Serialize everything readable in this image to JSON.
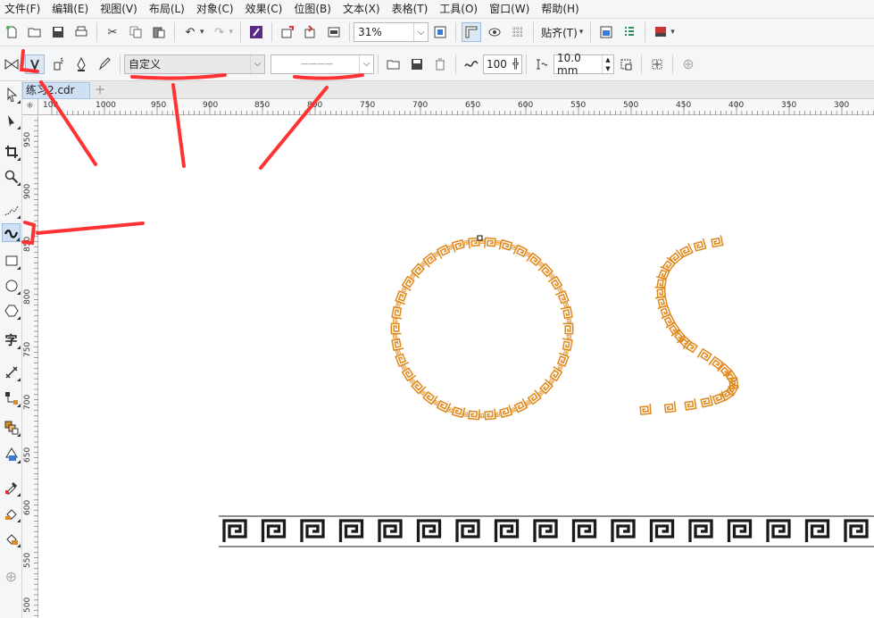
{
  "menu": [
    "文件(F)",
    "编辑(E)",
    "视图(V)",
    "布局(L)",
    "对象(C)",
    "效果(C)",
    "位图(B)",
    "文本(X)",
    "表格(T)",
    "工具(O)",
    "窗口(W)",
    "帮助(H)"
  ],
  "standard_toolbar": {
    "zoom_value": "31%",
    "snap_label": "贴齐(T)"
  },
  "property_bar": {
    "preset_value": "自定义",
    "stroke_value": "————",
    "smoothness_value": "100",
    "width_value": "10.0 mm"
  },
  "document": {
    "tab_label": "练习2.cdr",
    "add_tab_glyph": "+"
  },
  "rulers": {
    "corner_glyph": "⁜",
    "horizontal_labels": [
      "100",
      "1000",
      "950",
      "900",
      "850",
      "800",
      "750",
      "700",
      "650",
      "600",
      "550",
      "500",
      "450",
      "400",
      "350",
      "300"
    ],
    "vertical_labels": [
      "950",
      "900",
      "850",
      "800",
      "750",
      "700",
      "650",
      "600",
      "550",
      "500"
    ]
  },
  "colors": {
    "pattern_orange": "#e08a1e",
    "pattern_line": "#1a1a1a",
    "annotation_red": "#ff3333",
    "active_tool_bg": "#cfe0f5"
  },
  "icons": {
    "active_tool": "artistic-media-icon"
  }
}
